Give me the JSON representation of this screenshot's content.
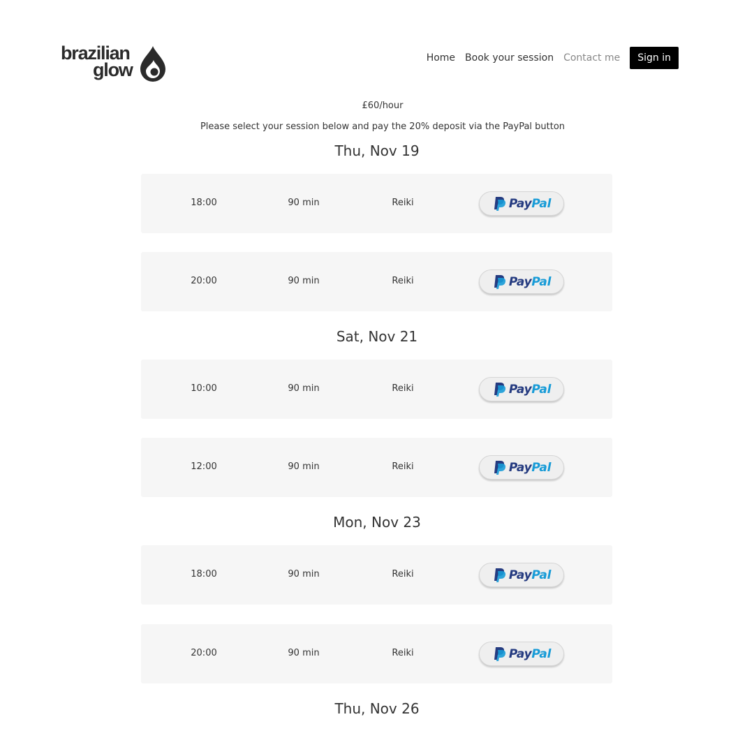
{
  "header": {
    "logo_line1": "brazilian",
    "logo_line2": "glow",
    "nav": [
      {
        "label": "Home"
      },
      {
        "label": "Book your session"
      },
      {
        "label": "Contact me"
      }
    ],
    "signin_label": "Sign in"
  },
  "intro": {
    "price": "£60/hour",
    "instructions": "Please select your session below and pay the 20% deposit via the PayPal button"
  },
  "colors": {
    "paypal_dark": "#253b80",
    "paypal_light": "#179bd7",
    "signin_bg": "#000000",
    "slot_bg": "#f6f6f6"
  },
  "days": [
    {
      "title": "Thu, Nov 19",
      "slots": [
        {
          "time": "18:00",
          "duration": "90 min",
          "type": "Reiki",
          "pay_label_1": "Pay",
          "pay_label_2": "Pal"
        },
        {
          "time": "20:00",
          "duration": "90 min",
          "type": "Reiki",
          "pay_label_1": "Pay",
          "pay_label_2": "Pal"
        }
      ]
    },
    {
      "title": "Sat, Nov 21",
      "slots": [
        {
          "time": "10:00",
          "duration": "90 min",
          "type": "Reiki",
          "pay_label_1": "Pay",
          "pay_label_2": "Pal"
        },
        {
          "time": "12:00",
          "duration": "90 min",
          "type": "Reiki",
          "pay_label_1": "Pay",
          "pay_label_2": "Pal"
        }
      ]
    },
    {
      "title": "Mon, Nov 23",
      "slots": [
        {
          "time": "18:00",
          "duration": "90 min",
          "type": "Reiki",
          "pay_label_1": "Pay",
          "pay_label_2": "Pal"
        },
        {
          "time": "20:00",
          "duration": "90 min",
          "type": "Reiki",
          "pay_label_1": "Pay",
          "pay_label_2": "Pal"
        }
      ]
    },
    {
      "title": "Thu, Nov 26",
      "slots": []
    }
  ]
}
